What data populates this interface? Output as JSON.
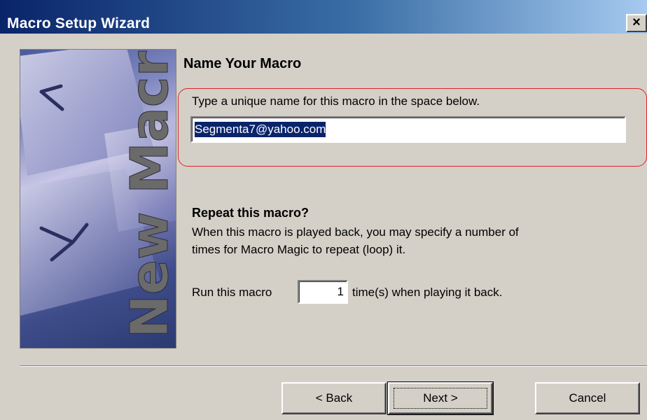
{
  "window": {
    "title": "Macro Setup Wizard",
    "close_glyph": "×"
  },
  "side_panel": {
    "logo_text": "New Macro",
    "icon": "keyboard-keys-image"
  },
  "name_section": {
    "heading": "Name Your Macro",
    "instruction": "Type a unique name for this macro in the space below.",
    "name_value": "Segmenta7@yahoo.com"
  },
  "repeat_section": {
    "heading": "Repeat this macro?",
    "description_line1": "When this macro is played back, you may specify a number of",
    "description_line2": "times for Macro Magic to repeat (loop) it.",
    "run_prefix": "Run this macro",
    "run_count": "1",
    "run_suffix": "time(s) when playing it back."
  },
  "buttons": {
    "back": "< Back",
    "next": "Next >",
    "cancel": "Cancel"
  },
  "colors": {
    "highlight": "#e0232a",
    "titlebar": "#0a246a",
    "dialog_bg": "#d4d0c8"
  }
}
